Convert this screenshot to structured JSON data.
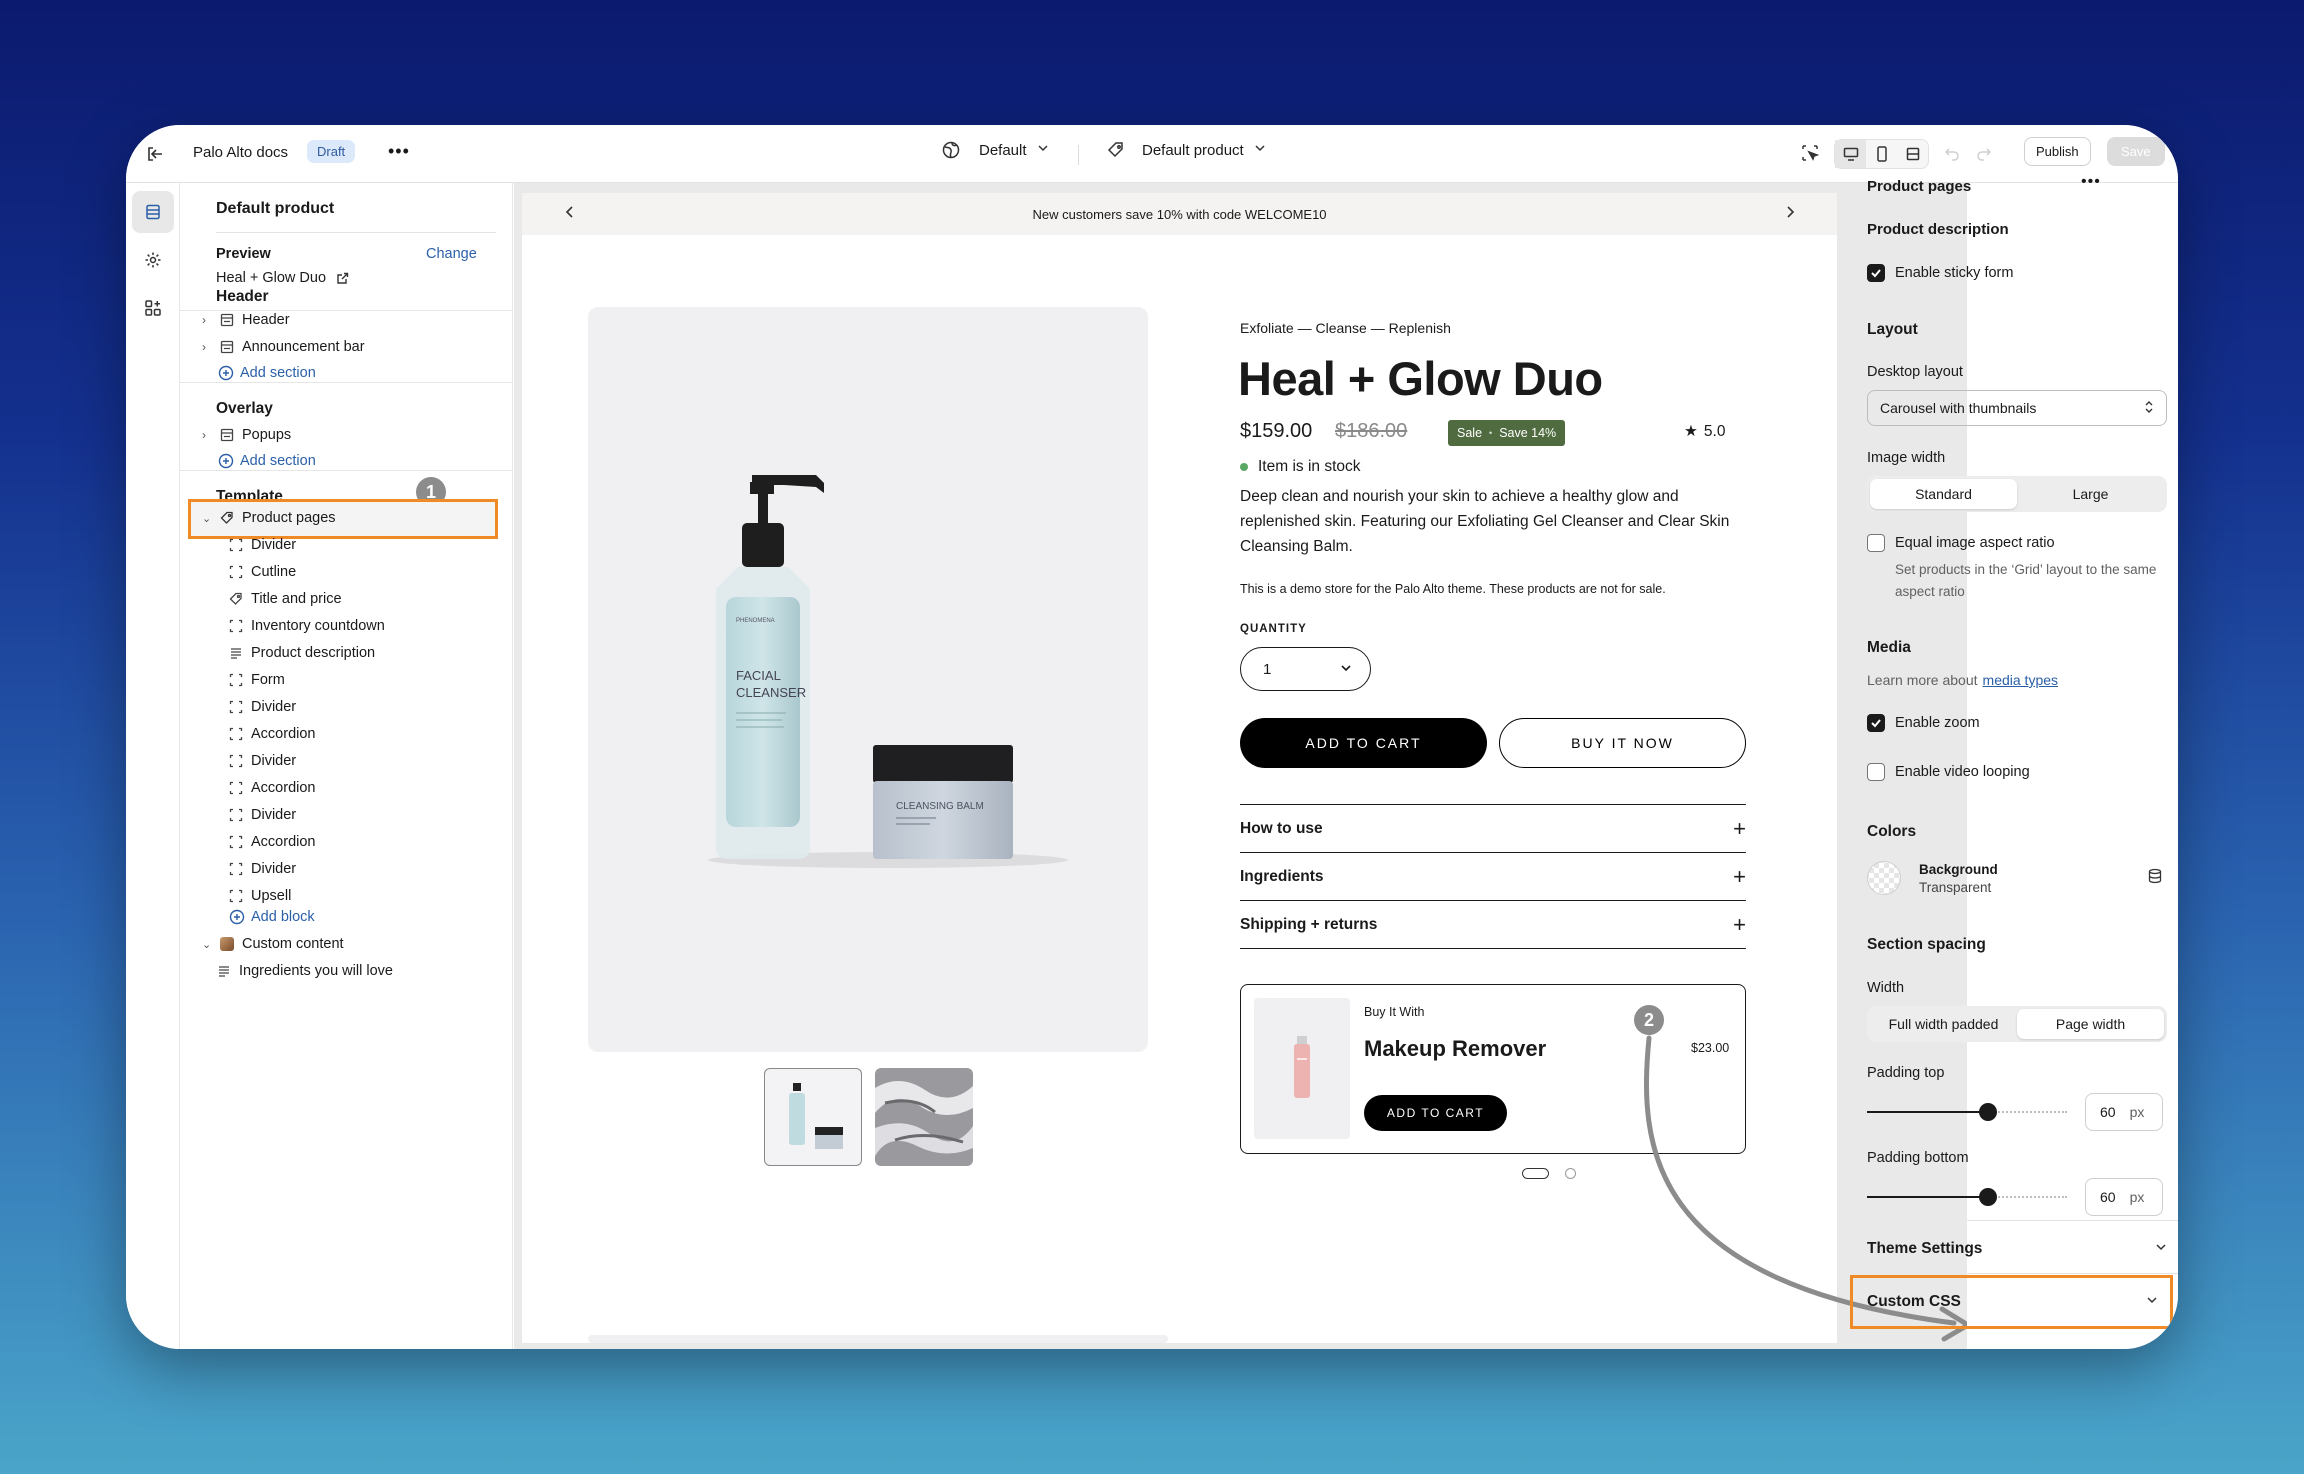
{
  "topbar": {
    "store_name": "Palo Alto docs",
    "status": "Draft",
    "theme_selector": "Default",
    "template_selector": "Default product",
    "publish_label": "Publish",
    "save_label": "Save"
  },
  "left_panel": {
    "title": "Default product",
    "preview_label": "Preview",
    "change_label": "Change",
    "preview_product": "Heal + Glow Duo",
    "header_group": {
      "heading": "Header",
      "items": [
        "Header",
        "Announcement bar"
      ],
      "add_section": "Add section"
    },
    "overlay_group": {
      "heading": "Overlay",
      "items": [
        "Popups"
      ],
      "add_section": "Add section"
    },
    "template_group": {
      "heading": "Template",
      "section": "Product pages",
      "blocks": [
        "Divider",
        "Cutline",
        "Title and price",
        "Inventory countdown",
        "Product description",
        "Form",
        "Divider",
        "Accordion",
        "Divider",
        "Accordion",
        "Divider",
        "Accordion",
        "Divider",
        "Upsell"
      ],
      "add_block": "Add block",
      "custom_content": "Custom content",
      "custom_content_child": "Ingredients you will love"
    }
  },
  "steps": {
    "one": "1",
    "two": "2"
  },
  "preview": {
    "announcement": "New customers save 10% with code WELCOME10",
    "eyebrow": "Exfoliate — Cleanse — Replenish",
    "title": "Heal + Glow Duo",
    "price": "$159.00",
    "compare_price": "$186.00",
    "sale_badge": "Sale",
    "save_badge": "Save 14%",
    "rating": "5.0",
    "stock": "Item is in stock",
    "description": "Deep clean and nourish your skin to achieve a healthy glow and replenished skin. Featuring our Exfoliating Gel Cleanser and Clear Skin Cleansing Balm.",
    "demo_note": "This is a demo store for the Palo Alto theme. These products are not for sale.",
    "quantity_label": "QUANTITY",
    "quantity_value": "1",
    "add_to_cart": "ADD TO CART",
    "buy_now": "BUY IT NOW",
    "accordions": [
      "How to use",
      "Ingredients",
      "Shipping + returns"
    ],
    "upsell": {
      "eyebrow": "Buy It With",
      "name": "Makeup Remover",
      "price": "$23.00",
      "button": "ADD TO CART"
    },
    "bottle": {
      "brand": "PHENOMENA",
      "line1": "FACIAL",
      "line2": "CLEANSER"
    },
    "jar": {
      "label": "CLEANSING BALM"
    }
  },
  "right_panel": {
    "section_title": "Product pages",
    "product_description": "Product description",
    "sticky_form": "Enable sticky form",
    "layout_heading": "Layout",
    "desktop_layout_label": "Desktop layout",
    "desktop_layout_value": "Carousel with thumbnails",
    "image_width_label": "Image width",
    "image_width_options": [
      "Standard",
      "Large"
    ],
    "equal_ratio_label": "Equal image aspect ratio",
    "equal_ratio_help": "Set products in the ‘Grid’ layout to the same aspect ratio",
    "media_heading": "Media",
    "media_help_prefix": "Learn more about",
    "media_help_link": "media types",
    "enable_zoom": "Enable zoom",
    "enable_video_looping": "Enable video looping",
    "colors_heading": "Colors",
    "background_label": "Background",
    "background_value": "Transparent",
    "spacing_heading": "Section spacing",
    "width_label": "Width",
    "width_options": [
      "Full width padded",
      "Page width"
    ],
    "padding_top_label": "Padding top",
    "padding_top_value": "60",
    "padding_bottom_label": "Padding bottom",
    "padding_bottom_value": "60",
    "unit": "px",
    "theme_settings": "Theme Settings",
    "custom_css": "Custom CSS"
  },
  "colors": {
    "highlight": "#f08a24",
    "link": "#2a5fa8",
    "sale_badge": "#4f6b3f",
    "in_stock": "#5aa864"
  }
}
